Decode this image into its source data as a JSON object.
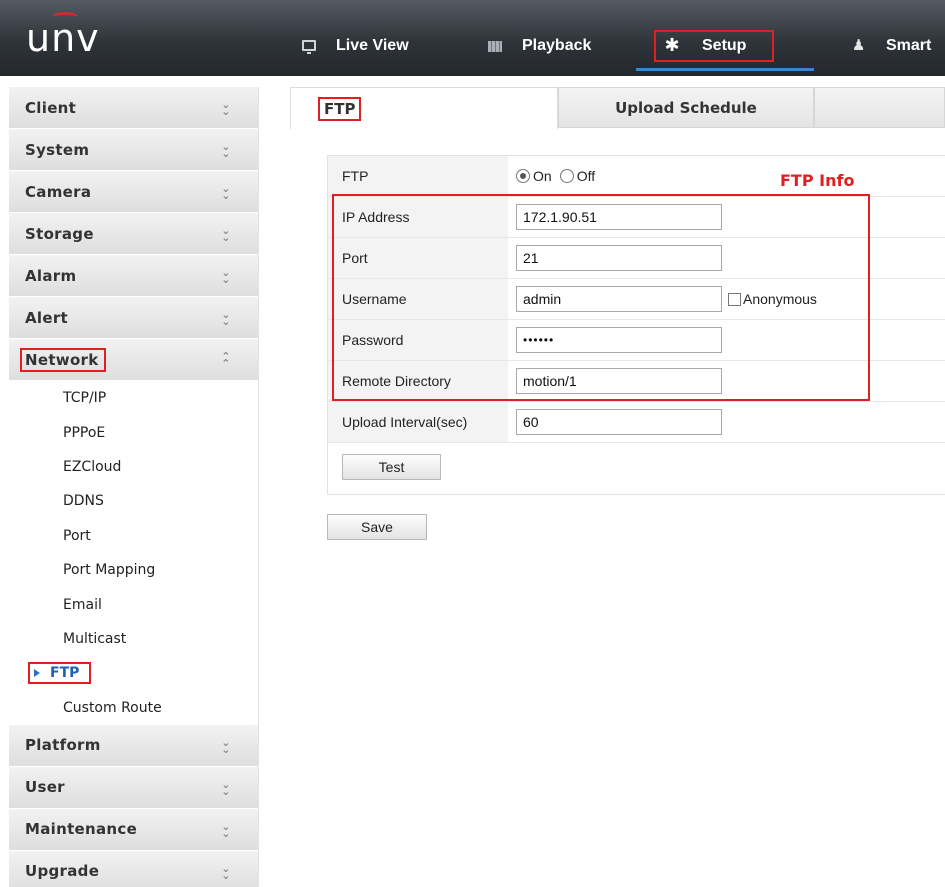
{
  "header": {
    "logo": "unv",
    "nav": [
      {
        "label": "Live View",
        "icon": "monitor-icon"
      },
      {
        "label": "Playback",
        "icon": "film-icon"
      },
      {
        "label": "Setup",
        "icon": "gear-icon"
      },
      {
        "label": "Smart",
        "icon": "person-icon"
      }
    ],
    "active_nav": "Setup"
  },
  "sidebar": {
    "sections": [
      {
        "label": "Client"
      },
      {
        "label": "System"
      },
      {
        "label": "Camera"
      },
      {
        "label": "Storage"
      },
      {
        "label": "Alarm"
      },
      {
        "label": "Alert"
      },
      {
        "label": "Network",
        "expanded": true
      },
      {
        "label": "Platform"
      },
      {
        "label": "User"
      },
      {
        "label": "Maintenance"
      },
      {
        "label": "Upgrade"
      }
    ],
    "network_items": [
      "TCP/IP",
      "PPPoE",
      "EZCloud",
      "DDNS",
      "Port",
      "Port Mapping",
      "Email",
      "Multicast",
      "FTP",
      "Custom Route"
    ],
    "active_item": "FTP"
  },
  "tabs": [
    {
      "label": "FTP",
      "active": true
    },
    {
      "label": "Upload Schedule",
      "active": false
    }
  ],
  "form": {
    "ftp": {
      "label": "FTP",
      "on_label": "On",
      "off_label": "Off",
      "selected": "On"
    },
    "ip_address": {
      "label": "IP Address",
      "value": "172.1.90.51"
    },
    "port": {
      "label": "Port",
      "value": "21"
    },
    "username": {
      "label": "Username",
      "value": "admin",
      "anonymous_label": "Anonymous",
      "anonymous_checked": false
    },
    "password": {
      "label": "Password",
      "value": "••••••"
    },
    "remote_directory": {
      "label": "Remote Directory",
      "value": "motion/1"
    },
    "upload_interval": {
      "label": "Upload Interval(sec)",
      "value": "60"
    },
    "test_label": "Test",
    "save_label": "Save"
  },
  "annotation": {
    "label": "FTP Info",
    "color": "#e02020"
  }
}
